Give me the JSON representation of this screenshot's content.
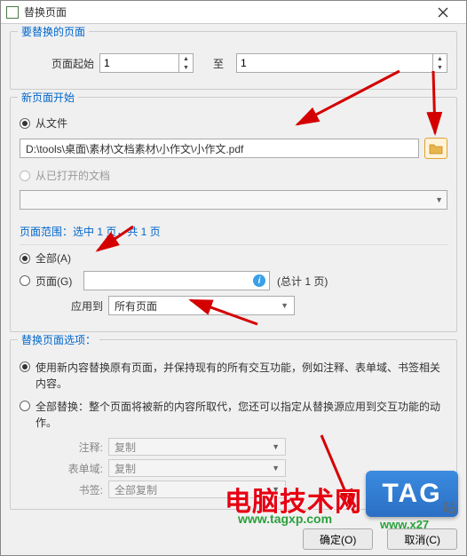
{
  "window": {
    "title": "替换页面"
  },
  "group1": {
    "title": "要替换的页面",
    "fromLabel": "页面起始",
    "fromValue": "1",
    "toLabel": "至",
    "toValue": "1"
  },
  "group2": {
    "title": "新页面开始",
    "fromFile": {
      "label": "从文件",
      "path": "D:\\tools\\桌面\\素材\\文档素材\\小作文\\小作文.pdf"
    },
    "fromOpen": {
      "label": "从已打开的文档",
      "combo": ""
    },
    "range": {
      "title": "页面范围：选中 1 页，共 1 页",
      "allLabel": "全部(A)",
      "pagesLabel": "页面(G)",
      "totalLabel": "(总计 1 页)",
      "applyLabel": "应用到",
      "applyValue": "所有页面"
    }
  },
  "group3": {
    "title": "替换页面选项：",
    "opt1": "使用新内容替换原有页面，并保持现有的所有交互功能，例如注释、表单域、书签相关内容。",
    "opt2": "全部替换：整个页面将被新的内容所取代，您还可以指定从替换源应用到交互功能的动作。",
    "annotLabel": "注释:",
    "annotValue": "复制",
    "formLabel": "表单域:",
    "formValue": "复制",
    "bookmarkLabel": "书签:",
    "bookmarkValue": "全部复制"
  },
  "footer": {
    "ok": "确定(O)",
    "cancel": "取消(C)"
  },
  "watermark": {
    "site": "电脑技术网",
    "url": "www.tagxp.com",
    "tag": "TAG",
    "tagUrl": "www.x27",
    "zhan": "站"
  }
}
